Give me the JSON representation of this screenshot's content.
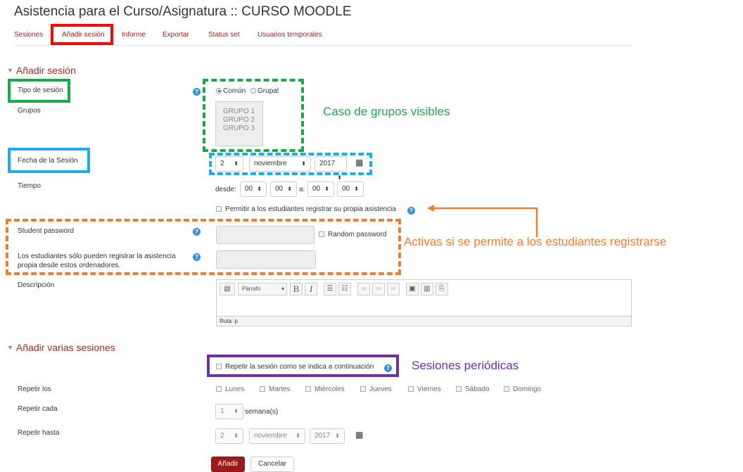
{
  "page": {
    "title": "Asistencia para el Curso/Asignatura :: CURSO MOODLE"
  },
  "tabs": [
    {
      "label": "Sesiones"
    },
    {
      "label": "Añadir sesión"
    },
    {
      "label": "Informe"
    },
    {
      "label": "Exportar"
    },
    {
      "label": "Status set"
    },
    {
      "label": "Usuarios temporales"
    }
  ],
  "add_session": {
    "heading": "Añadir sesión",
    "session_type": {
      "label": "Tipo de sesión",
      "options": [
        "Común",
        "Grupal"
      ],
      "selected": "Común"
    },
    "groups": {
      "label": "Grupos",
      "items": [
        "GRUPO 1",
        "GRUPO 2",
        "GRUPO 3"
      ]
    },
    "date": {
      "label": "Fecha de la Sesión",
      "day": "2",
      "month": "noviembre",
      "year": "2017"
    },
    "time": {
      "label": "Tiempo",
      "from_label": "desde:",
      "from_h": "00",
      "from_m": "00",
      "to_label": "a:",
      "to_h": "00",
      "to_m": "00"
    },
    "self_register": {
      "label": "Permitir a los estudiantes registrar su propia asistencia"
    },
    "student_password": {
      "label": "Student password",
      "value": "",
      "random_label": "Random password"
    },
    "ip_restrict": {
      "label_line1": "Los estudiantes sólo pueden registrar la asistencia",
      "label_line2": "propia desde estos ordenadores.",
      "value": ""
    },
    "description": {
      "label": "Descripción",
      "paragraph": "Párrafo",
      "path": "Ruta: p"
    }
  },
  "multi": {
    "heading": "Añadir varias sesiones",
    "repeat_check": "Repetir la sesión como se indica a continuación",
    "repeat_on": {
      "label": "Repetir los",
      "days": [
        "Lunes",
        "Martes",
        "Miércoles",
        "Jueves",
        "Viernes",
        "Sábado",
        "Domingo"
      ]
    },
    "repeat_every": {
      "label": "Repetir cada",
      "value": "1",
      "unit": "semana(s)"
    },
    "repeat_until": {
      "label": "Repetir hasta",
      "day": "2",
      "month": "noviembre",
      "year": "2017"
    }
  },
  "buttons": {
    "submit": "Añadir",
    "cancel": "Cancelar"
  },
  "annotations": {
    "groups_visible": "Caso de grupos visibles",
    "self_register": "Activas si se permite a los estudiantes registrarse",
    "periodic": "Sesiones periódicas"
  },
  "colors": {
    "green": "#1aa84a",
    "blue": "#1aaef0",
    "orange": "#ed7d31",
    "purple": "#7030a0",
    "red": "#ff0000",
    "brand": "#9e1a1a"
  }
}
